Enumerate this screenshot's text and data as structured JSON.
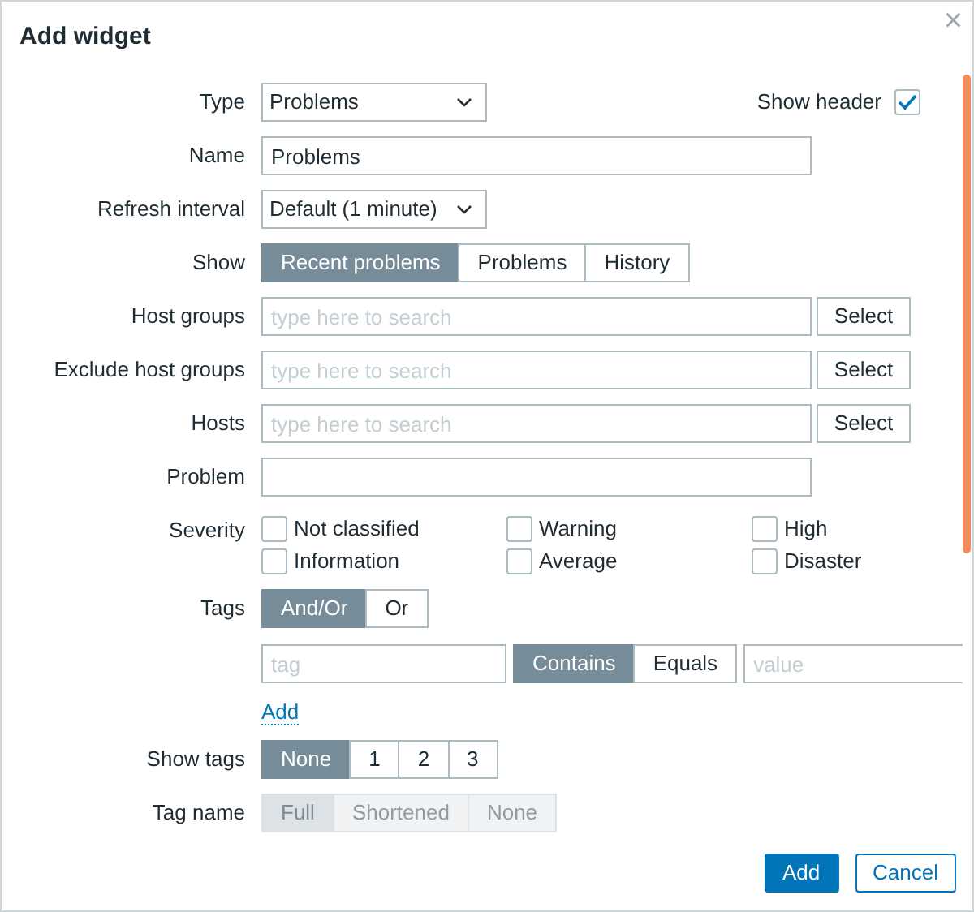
{
  "dialog": {
    "title": "Add widget",
    "close": "×"
  },
  "fields": [
    {
      "kind": "select",
      "label": "Type",
      "value": "Problems",
      "extra": {
        "label": "Show header",
        "checked": true
      }
    },
    {
      "kind": "text",
      "label": "Name",
      "value": "Problems"
    },
    {
      "kind": "select",
      "label": "Refresh interval",
      "value": "Default (1 minute)"
    },
    {
      "kind": "segmented",
      "label": "Show",
      "options": [
        {
          "label": "Recent problems",
          "selected": true
        },
        {
          "label": "Problems",
          "selected": false
        },
        {
          "label": "History",
          "selected": false
        }
      ]
    },
    {
      "kind": "multiselect",
      "label": "Host groups",
      "placeholder": "type here to search",
      "button": "Select"
    },
    {
      "kind": "multiselect",
      "label": "Exclude host groups",
      "placeholder": "type here to search",
      "button": "Select"
    },
    {
      "kind": "multiselect",
      "label": "Hosts",
      "placeholder": "type here to search",
      "button": "Select"
    },
    {
      "kind": "text",
      "label": "Problem"
    },
    {
      "kind": "checkboxes",
      "label": "Severity",
      "options": [
        {
          "label": "Not classified",
          "checked": false
        },
        {
          "label": "Warning",
          "checked": false
        },
        {
          "label": "High",
          "checked": false
        },
        {
          "label": "Information",
          "checked": false
        },
        {
          "label": "Average",
          "checked": false
        },
        {
          "label": "Disaster",
          "checked": false
        }
      ]
    },
    {
      "kind": "tags",
      "label": "Tags",
      "operator": [
        {
          "label": "And/Or",
          "selected": true
        },
        {
          "label": "Or",
          "selected": false
        }
      ],
      "filters": [
        {
          "tag_placeholder": "tag",
          "match": [
            {
              "label": "Contains",
              "selected": true
            },
            {
              "label": "Equals",
              "selected": false
            }
          ],
          "value_placeholder": "value"
        }
      ],
      "add_link": "Add"
    },
    {
      "kind": "segmented",
      "label": "Show tags",
      "options": [
        {
          "label": "None",
          "selected": true
        },
        {
          "label": "1",
          "selected": false
        },
        {
          "label": "2",
          "selected": false
        },
        {
          "label": "3",
          "selected": false
        }
      ]
    },
    {
      "kind": "segmented",
      "label": "Tag name",
      "disabled": true,
      "options": [
        {
          "label": "Full",
          "selected": true
        },
        {
          "label": "Shortened",
          "selected": false
        },
        {
          "label": "None",
          "selected": false
        }
      ]
    }
  ],
  "buttons": [
    {
      "label": "Add",
      "kind": "primary"
    },
    {
      "label": "Cancel",
      "kind": "secondary"
    }
  ]
}
